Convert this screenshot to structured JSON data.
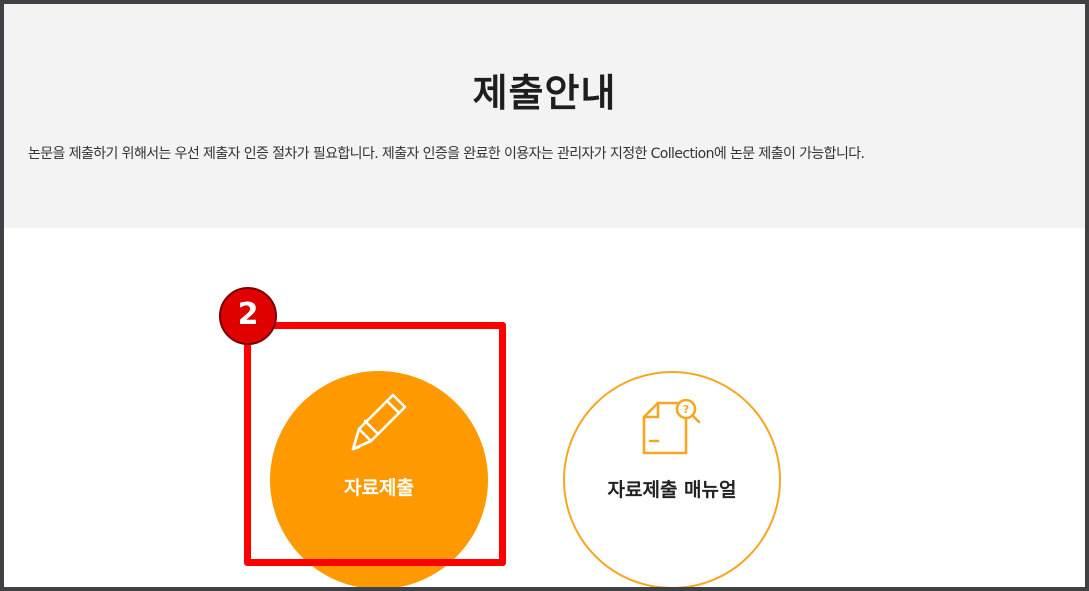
{
  "intro": {
    "title": "제출안내",
    "description": "논문을 제출하기 위해서는 우선 제출자 인증 절차가 필요합니다. 제출자 인증을 완료한 이용자는 관리자가 지정한 Collection에 논문 제출이 가능합니다."
  },
  "actions": {
    "submit": {
      "label": "자료제출",
      "icon": "pencil-icon",
      "color": "#ff9900"
    },
    "manual": {
      "label": "자료제출 매뉴얼",
      "icon": "document-search-icon",
      "color": "#f5a623"
    }
  },
  "annotation": {
    "step_number": "2",
    "color": "#ff0000"
  }
}
